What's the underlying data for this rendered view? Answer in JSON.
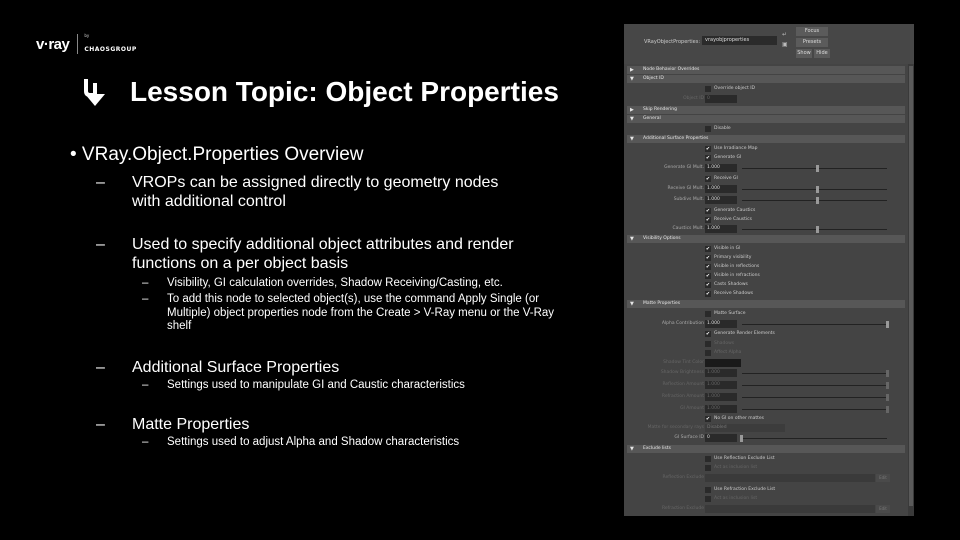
{
  "logo": {
    "brand": "v·ray",
    "by": "by",
    "company": "CHAOSGROUP"
  },
  "title": {
    "icon": "arrow-down-icon",
    "text": "Lesson Topic: Object Properties"
  },
  "bullets": {
    "main": "• VRay.Object.Properties Overview",
    "dash": "–",
    "items": [
      "VROPs can be assigned directly to geometry nodes with additional control",
      "Used to specify additional object attributes and render functions on a per object basis",
      "Additional Surface Properties",
      "Matte Properties"
    ],
    "sub": [
      "Visibility, GI calculation overrides, Shadow Receiving/Casting, etc.",
      "To add this node to selected object(s), use the command Apply Single (or Multiple) object properties node from the Create > V-Ray menu or the V-Ray shelf",
      "Settings used to manipulate GI and Caustic characteristics",
      "Settings used to adjust Alpha and Shadow characteristics"
    ]
  },
  "panel": {
    "header": {
      "label": "VRayObjectProperties:",
      "value": "vrayobjproperties",
      "buttons": [
        "Focus",
        "Presets",
        "Show",
        "Hide"
      ]
    },
    "sections": {
      "node_behavior": "Node Behavior Overrides",
      "object_id": "Object ID",
      "skip_rendering": "Skip Rendering",
      "general": "General",
      "additional_surface": "Additional Surface Properties",
      "visibility": "Visibility Options",
      "matte": "Matte Properties",
      "exclude": "Exclude lists"
    },
    "object_id": {
      "override": "Override object ID",
      "label": "Object ID",
      "value": "0"
    },
    "general": {
      "disable": "Disable"
    },
    "surface": {
      "use_irradiance": "Use Irradiance Map",
      "generate_gi": "Generate GI",
      "generate_gi_mult_label": "Generate GI Mult.",
      "generate_gi_mult": "1.000",
      "receive_gi": "Receive GI",
      "receive_gi_mult_label": "Receive GI Mult.",
      "receive_gi_mult": "1.000",
      "subdivs_mult_label": "Subdivs Mult.",
      "subdivs_mult": "1.000",
      "generate_caustics": "Generate Caustics",
      "receive_caustics": "Receive Caustics",
      "caustics_mult_label": "Caustics Mult.",
      "caustics_mult": "1.000"
    },
    "visibility": [
      "Visible in GI",
      "Primary visibility",
      "Visible in reflections",
      "Visible in refractions",
      "Casts Shadows",
      "Receive Shadows"
    ],
    "matte": {
      "matte_surface": "Matte Surface",
      "alpha_label": "Alpha Contribution",
      "alpha_value": "1.000",
      "gen_render_elements": "Generate Render Elements",
      "shadows": "Shadows",
      "affect_alpha": "Affect Alpha",
      "shadow_tint_color": "Shadow Tint Color",
      "shadow_brightness_label": "Shadow Brightness",
      "shadow_brightness": "1.000",
      "reflection_amount_label": "Reflection Amount",
      "reflection_amount": "1.000",
      "refraction_amount_label": "Refraction Amount",
      "refraction_amount": "1.000",
      "gi_amount_label": "GI Amount",
      "gi_amount": "1.000",
      "no_gi_other_mattes": "No GI on other mattes",
      "matte_secondary_label": "Matte for secondary rays",
      "matte_secondary_value": "Disabled",
      "gi_surface_id_label": "GI Surface ID",
      "gi_surface_id": "0"
    },
    "exclude": {
      "use_refl": "Use Reflection Exclude List",
      "refl_inclusive": "Act as inclusion list",
      "refl_label": "Reflection Exclude",
      "use_refr": "Use Refraction Exclude List",
      "refr_inclusive": "Act as inclusion list",
      "refr_label": "Refraction Exclude",
      "edit": "Edit"
    },
    "icons": {
      "collapsed": "▶",
      "expanded": "▼",
      "check": "✔"
    }
  }
}
